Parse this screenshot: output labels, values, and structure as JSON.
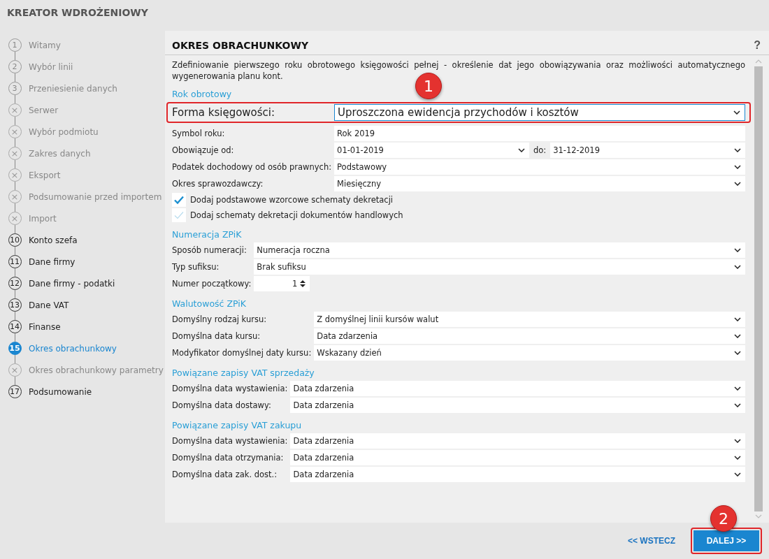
{
  "window": {
    "title": "KREATOR WDROŻENIOWY"
  },
  "steps": [
    {
      "marker": "1",
      "label": "Witamy",
      "kind": "visited",
      "selected": false
    },
    {
      "marker": "2",
      "label": "Wybór linii",
      "kind": "visited",
      "selected": false
    },
    {
      "marker": "3",
      "label": "Przeniesienie danych",
      "kind": "visited",
      "selected": false
    },
    {
      "marker": "×",
      "label": "Serwer",
      "kind": "skipped",
      "selected": false
    },
    {
      "marker": "×",
      "label": "Wybór podmiotu",
      "kind": "skipped",
      "selected": false
    },
    {
      "marker": "×",
      "label": "Zakres danych",
      "kind": "skipped",
      "selected": false
    },
    {
      "marker": "×",
      "label": "Eksport",
      "kind": "skipped",
      "selected": false
    },
    {
      "marker": "×",
      "label": "Podsumowanie przed importem",
      "kind": "skipped",
      "selected": false
    },
    {
      "marker": "×",
      "label": "Import",
      "kind": "skipped",
      "selected": false
    },
    {
      "marker": "10",
      "label": "Konto szefa",
      "kind": "upcoming",
      "selected": false
    },
    {
      "marker": "11",
      "label": "Dane firmy",
      "kind": "upcoming",
      "selected": false
    },
    {
      "marker": "12",
      "label": "Dane firmy - podatki",
      "kind": "upcoming",
      "selected": false
    },
    {
      "marker": "13",
      "label": "Dane VAT",
      "kind": "upcoming",
      "selected": false
    },
    {
      "marker": "14",
      "label": "Finanse",
      "kind": "upcoming",
      "selected": false
    },
    {
      "marker": "15",
      "label": "Okres obrachunkowy",
      "kind": "current",
      "selected": true
    },
    {
      "marker": "×",
      "label": "Okres obrachunkowy parametry",
      "kind": "skipped",
      "selected": false
    },
    {
      "marker": "17",
      "label": "Podsumowanie",
      "kind": "upcoming",
      "selected": false
    }
  ],
  "page": {
    "title": "OKRES OBRACHUNKOWY",
    "help": "?",
    "description": "Zdefiniowanie pierwszego roku obrotowego księgowości pełnej - określenie dat jego obowiązywania oraz możliwości automatycznego wygenerowania planu kont."
  },
  "sections": [
    {
      "title": "Rok obrotowy",
      "rows": [
        {
          "kind": "select",
          "label": "Forma księgowości:",
          "value": "Uproszczona ewidencja przychodów i kosztów",
          "highlighted": true,
          "callout": "1"
        },
        {
          "kind": "text",
          "label": "Symbol roku:",
          "value": "Rok 2019"
        },
        {
          "kind": "date_range",
          "label": "Obowiązuje od:",
          "value": "01-01-2019",
          "to_label": "do:",
          "to_value": "31-12-2019"
        },
        {
          "kind": "select",
          "label": "Podatek dochodowy od osób prawnych:",
          "value": "Podstawowy"
        },
        {
          "kind": "select",
          "label": "Okres sprawozdawczy:",
          "value": "Miesięczny"
        },
        {
          "kind": "checkbox",
          "label": "Dodaj podstawowe wzorcowe schematy dekretacji",
          "checked": true,
          "disabled": false
        },
        {
          "kind": "checkbox",
          "label": "Dodaj schematy dekretacji dokumentów handlowych",
          "checked": true,
          "disabled": true
        }
      ]
    },
    {
      "title": "Numeracja ZPiK",
      "rows": [
        {
          "kind": "select",
          "label": "Sposób numeracji:",
          "value": "Numeracja roczna"
        },
        {
          "kind": "select",
          "label": "Typ sufiksu:",
          "value": "Brak sufiksu"
        },
        {
          "kind": "spinner",
          "label": "Numer początkowy:",
          "value": "1"
        }
      ]
    },
    {
      "title": "Walutowość ZPiK",
      "rows": [
        {
          "kind": "select",
          "label": "Domyślny rodzaj kursu:",
          "value": "Z domyślnej linii kursów walut"
        },
        {
          "kind": "select",
          "label": "Domyślna data kursu:",
          "value": "Data zdarzenia"
        },
        {
          "kind": "select",
          "label": "Modyfikator domyślnej daty kursu:",
          "value": "Wskazany dzień"
        }
      ]
    },
    {
      "title": "Powiązane zapisy VAT sprzedaży",
      "rows": [
        {
          "kind": "select",
          "label": "Domyślna data wystawienia:",
          "value": "Data zdarzenia"
        },
        {
          "kind": "select",
          "label": "Domyślna data dostawy:",
          "value": "Data zdarzenia"
        }
      ]
    },
    {
      "title": "Powiązane zapisy VAT zakupu",
      "rows": [
        {
          "kind": "select",
          "label": "Domyślna data wystawienia:",
          "value": "Data zdarzenia"
        },
        {
          "kind": "select",
          "label": "Domyślna data otrzymania:",
          "value": "Data zdarzenia"
        },
        {
          "kind": "select",
          "label": "Domyślna data zak. dost.:",
          "value": "Data zdarzenia"
        }
      ]
    }
  ],
  "footer": {
    "back": {
      "label": "<< WSTECZ"
    },
    "next": {
      "label": "DALEJ >>",
      "highlighted": true,
      "callout": "2"
    }
  }
}
